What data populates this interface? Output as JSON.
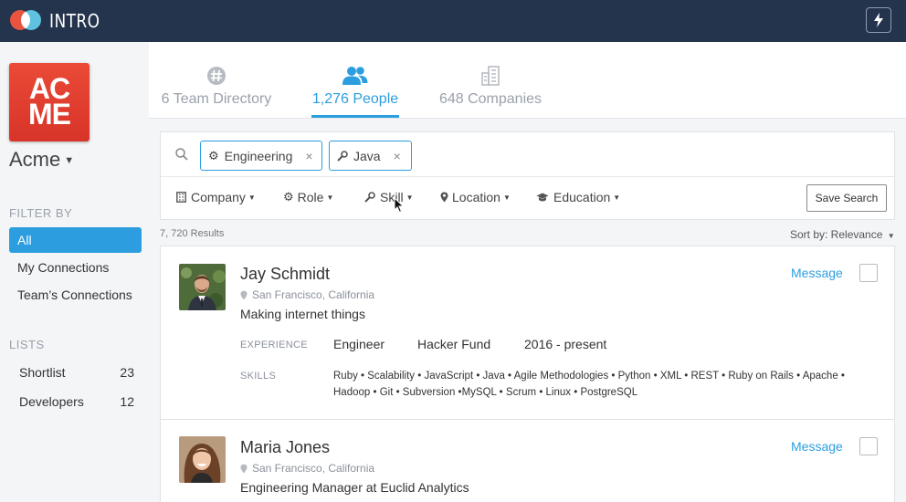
{
  "app": {
    "name": "INTRO"
  },
  "org": {
    "logo_text": "AC ME",
    "logo_line1": "AC",
    "logo_line2": "ME",
    "name": "Acme"
  },
  "sidebar": {
    "filter_label": "FILTER BY",
    "filters": [
      {
        "label": "All",
        "active": true
      },
      {
        "label": "My Connections",
        "active": false
      },
      {
        "label": "Team’s Connections",
        "active": false
      }
    ],
    "lists_label": "LISTS",
    "lists": [
      {
        "label": "Shortlist",
        "count": "23"
      },
      {
        "label": "Developers",
        "count": "12"
      }
    ]
  },
  "tabs": [
    {
      "label": "6 Team Directory",
      "icon": "slack-hash-icon",
      "active": false
    },
    {
      "label": "1,276 People",
      "icon": "people-icon",
      "active": true
    },
    {
      "label": "648 Companies",
      "icon": "buildings-icon",
      "active": false
    }
  ],
  "search": {
    "chips": [
      {
        "label": "Engineering",
        "icon": "gear-icon"
      },
      {
        "label": "Java",
        "icon": "wrench-icon"
      }
    ],
    "filters": [
      {
        "label": "Company",
        "icon": "building-icon"
      },
      {
        "label": "Role",
        "icon": "gear-icon"
      },
      {
        "label": "Skill",
        "icon": "wrench-icon"
      },
      {
        "label": "Location",
        "icon": "pin-icon"
      },
      {
        "label": "Education",
        "icon": "graduation-cap-icon"
      }
    ],
    "save_label": "Save Search"
  },
  "results": {
    "count_text": "7, 720 Results",
    "sort_text": "Sort by: Relevance"
  },
  "people": [
    {
      "name": "Jay Schmidt",
      "location": "San Francisco, California",
      "headline": "Making internet things",
      "message_label": "Message",
      "experience_label": "EXPERIENCE",
      "experience": {
        "role": "Engineer",
        "company": "Hacker Fund",
        "period": "2016 - present"
      },
      "skills_label": "SKILLS",
      "skills_line1": "Ruby • Scalability • JavaScript • Java • Agile Methodologies • Python • XML • REST • Ruby on Rails • Apache •",
      "skills_line2": "Hadoop • Git • Subversion •MySQL • Scrum • Linux • PostgreSQL"
    },
    {
      "name": "Maria Jones",
      "location": "San Francisco, California",
      "headline": "Engineering Manager at Euclid Analytics",
      "message_label": "Message"
    }
  ],
  "colors": {
    "topbar": "#24344d",
    "accent": "#2c9ee0",
    "acme_red": "#e0402f"
  }
}
